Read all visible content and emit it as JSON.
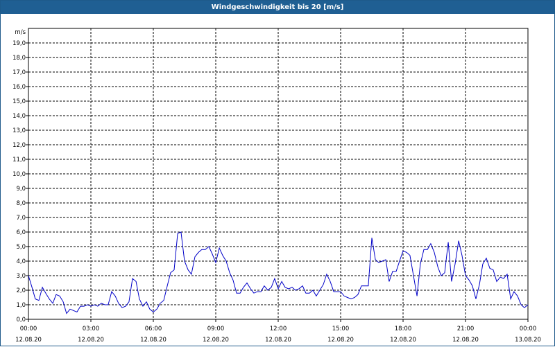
{
  "title": "Windgeschwindigkeit bis 20 [m/s]",
  "colors": {
    "titlebar": "#1f5f93",
    "line": "#0000c8",
    "grid": "#000000"
  },
  "chart_data": {
    "type": "line",
    "title": "Windgeschwindigkeit bis 20 [m/s]",
    "ylabel": "m/s",
    "ylim": [
      0,
      20
    ],
    "y_ticks": [
      "0,0",
      "1,0",
      "2,0",
      "3,0",
      "4,0",
      "5,0",
      "6,0",
      "7,0",
      "8,0",
      "9,0",
      "10,0",
      "11,0",
      "12,0",
      "13,0",
      "14,0",
      "15,0",
      "16,0",
      "17,0",
      "18,0",
      "19,0"
    ],
    "x_ticks": [
      {
        "time": "00:00",
        "date": "12.08.20"
      },
      {
        "time": "03:00",
        "date": "12.08.20"
      },
      {
        "time": "06:00",
        "date": "12.08.20"
      },
      {
        "time": "09:00",
        "date": "12.08.20"
      },
      {
        "time": "12:00",
        "date": "12.08.20"
      },
      {
        "time": "15:00",
        "date": "12.08.20"
      },
      {
        "time": "18:00",
        "date": "12.08.20"
      },
      {
        "time": "21:00",
        "date": "12.08.20"
      },
      {
        "time": "00:00",
        "date": "13.08.20"
      }
    ],
    "grid": true,
    "series": [
      {
        "x_unit": "hours",
        "x": [
          0,
          0.17,
          0.33,
          0.5,
          0.67,
          0.83,
          1.0,
          1.17,
          1.33,
          1.5,
          1.67,
          1.83,
          2.0,
          2.17,
          2.33,
          2.5,
          2.67,
          2.83,
          3.0,
          3.17,
          3.33,
          3.5,
          3.67,
          3.83,
          4.0,
          4.17,
          4.33,
          4.5,
          4.67,
          4.83,
          5.0,
          5.17,
          5.33,
          5.5,
          5.67,
          5.83,
          6.0,
          6.17,
          6.33,
          6.5,
          6.67,
          6.83,
          7.0,
          7.17,
          7.33,
          7.5,
          7.67,
          7.83,
          8.0,
          8.17,
          8.33,
          8.5,
          8.67,
          8.83,
          9.0,
          9.17,
          9.33,
          9.5,
          9.67,
          9.83,
          10.0,
          10.17,
          10.33,
          10.5,
          10.67,
          10.83,
          11.0,
          11.17,
          11.33,
          11.5,
          11.67,
          11.83,
          12.0,
          12.17,
          12.33,
          12.5,
          12.67,
          12.83,
          13.0,
          13.17,
          13.33,
          13.5,
          13.67,
          13.83,
          14.0,
          14.17,
          14.33,
          14.5,
          14.67,
          14.83,
          15.0,
          15.17,
          15.33,
          15.5,
          15.67,
          15.83,
          16.0,
          16.17,
          16.33,
          16.5,
          16.67,
          16.83,
          17.0,
          17.17,
          17.33,
          17.5,
          17.67,
          17.83,
          18.0,
          18.17,
          18.33,
          18.5,
          18.67,
          18.83,
          19.0,
          19.17,
          19.33,
          19.5,
          19.67,
          19.83,
          20.0,
          20.17,
          20.33,
          20.5,
          20.67,
          20.83,
          21.0,
          21.17,
          21.33,
          21.5,
          21.67,
          21.83,
          22.0,
          22.17,
          22.33,
          22.5,
          22.67,
          22.83,
          23.0,
          23.17,
          23.33,
          23.5,
          23.67,
          23.83,
          24.0
        ],
        "values": [
          3.0,
          2.2,
          1.4,
          1.3,
          2.2,
          1.8,
          1.4,
          1.1,
          1.7,
          1.6,
          1.2,
          0.4,
          0.7,
          0.6,
          0.5,
          0.9,
          0.9,
          1.0,
          0.9,
          1.0,
          0.9,
          1.1,
          1.0,
          1.0,
          1.9,
          1.6,
          1.1,
          0.8,
          0.9,
          1.2,
          2.8,
          2.6,
          1.4,
          0.9,
          1.2,
          0.7,
          0.5,
          0.7,
          1.1,
          1.3,
          2.3,
          3.2,
          3.4,
          5.9,
          6.0,
          4.0,
          3.4,
          3.1,
          4.3,
          4.6,
          4.8,
          4.8,
          5.0,
          4.5,
          3.9,
          4.9,
          4.4,
          4.0,
          3.2,
          2.7,
          1.8,
          1.8,
          2.2,
          2.5,
          2.1,
          1.8,
          1.9,
          1.9,
          2.3,
          2.0,
          2.2,
          2.8,
          2.1,
          2.6,
          2.2,
          2.1,
          2.2,
          2.0,
          2.1,
          2.3,
          1.8,
          1.8,
          2.0,
          1.6,
          2.0,
          2.4,
          3.1,
          2.6,
          1.9,
          1.9,
          1.9,
          1.6,
          1.5,
          1.4,
          1.5,
          1.7,
          2.3,
          2.3,
          2.3,
          5.6,
          4.1,
          3.9,
          4.0,
          4.1,
          2.6,
          3.3,
          3.3,
          4.0,
          4.7,
          4.6,
          4.4,
          3.0,
          1.6,
          3.8,
          4.8,
          4.8,
          5.2,
          4.6,
          3.6,
          3.0,
          3.2,
          5.3,
          2.6,
          3.8,
          5.4,
          4.4,
          3.0,
          2.7,
          2.3,
          1.4,
          2.4,
          3.8,
          4.2,
          3.5,
          3.4,
          2.6,
          2.9,
          2.8,
          3.1,
          1.4,
          1.9,
          1.6,
          1.0,
          0.8,
          1.0
        ]
      }
    ]
  }
}
